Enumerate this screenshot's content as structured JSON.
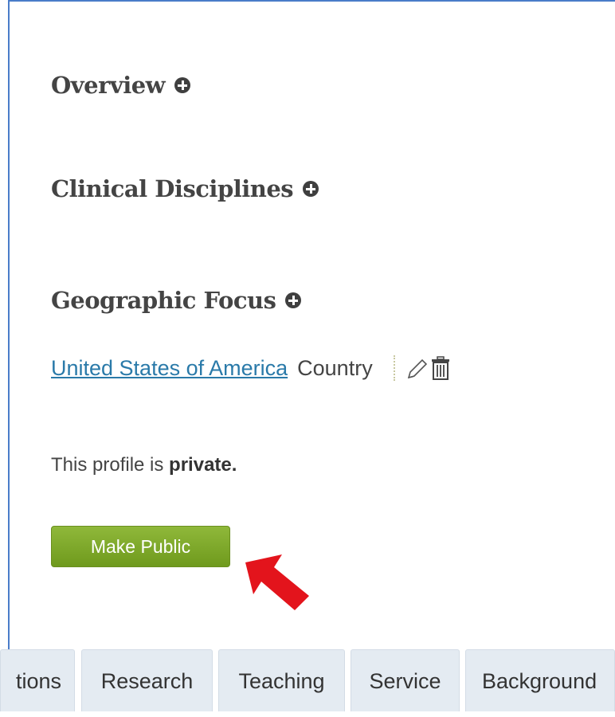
{
  "sections": [
    {
      "heading": "Overview"
    },
    {
      "heading": "Clinical Disciplines"
    },
    {
      "heading": "Geographic Focus"
    }
  ],
  "geographic_focus": {
    "link_text": "United States of America",
    "type_text": "Country",
    "edit_icon": "pencil-icon",
    "delete_icon": "trash-icon"
  },
  "privacy": {
    "prefix": "This profile is ",
    "status": "private."
  },
  "make_public_button": "Make Public",
  "tabs": [
    "tions",
    "Research",
    "Teaching",
    "Service",
    "Background"
  ],
  "annotation": {
    "arrow_color": "#e3141c"
  },
  "colors": {
    "button_green": "#7ca628",
    "link_blue": "#2a7aa9",
    "tab_bg": "#e4ebf2",
    "panel_border": "#4a7cc9"
  }
}
